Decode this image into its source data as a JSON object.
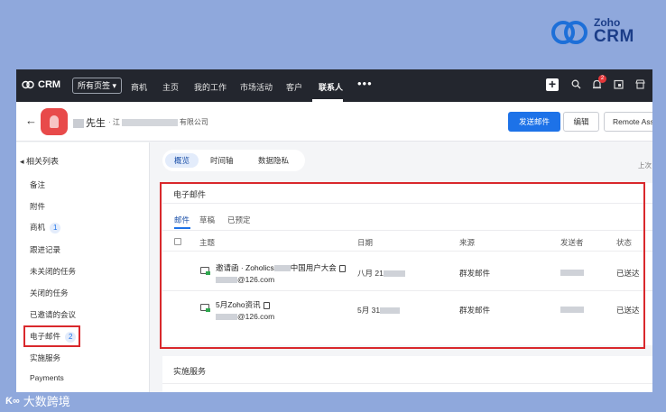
{
  "brand": {
    "line1": "Zoho",
    "line2": "CRM"
  },
  "topnav": {
    "logo": "CRM",
    "all_pages": "所有页签 ▾",
    "items": [
      "商机",
      "主页",
      "我的工作",
      "市场活动",
      "客户",
      "联系人"
    ],
    "active_item": "联系人",
    "more": "•••",
    "plus": "+",
    "notification_count": "2"
  },
  "record": {
    "name": "先生",
    "company_prefix": "· 江",
    "company_suffix": "有限公司",
    "send_email": "发送邮件",
    "edit": "编辑",
    "remote": "Remote Assist"
  },
  "sidebar": {
    "title": "相关列表",
    "items": [
      {
        "label": "备注"
      },
      {
        "label": "附件"
      },
      {
        "label": "商机",
        "count": "1"
      },
      {
        "label": "跟进记录"
      },
      {
        "label": "未关闭的任务"
      },
      {
        "label": "关闭的任务"
      },
      {
        "label": "已邀请的会议"
      },
      {
        "label": "电子邮件",
        "count": "2"
      },
      {
        "label": "实施服务"
      },
      {
        "label": "Payments"
      }
    ]
  },
  "tabs": [
    "概览",
    "时间轴",
    "数据隐私"
  ],
  "last_viewed": "上次",
  "email_card": {
    "title": "电子邮件",
    "subtabs": [
      "邮件",
      "草稿",
      "已预定"
    ],
    "columns": [
      "主题",
      "日期",
      "来源",
      "发送者",
      "状态"
    ],
    "rows": [
      {
        "subject_a": "邀请函 · Zoholics",
        "subject_b": "中国用户大会",
        "address": "@126.com",
        "date": "八月 21",
        "source": "群发邮件",
        "status": "已送达"
      },
      {
        "subject_a": "5月Zoho资讯",
        "subject_b": "",
        "address": "@126.com",
        "date": "5月 31",
        "source": "群发邮件",
        "status": "已送达"
      }
    ]
  },
  "service_card": {
    "title": "实施服务"
  },
  "watermark": {
    "logo": "Ƙ∞",
    "text": "大数跨境"
  },
  "colors": {
    "primary": "#1d72e8",
    "highlight": "#d9282c",
    "nav_bg": "#23262e",
    "page_bg": "#8fa8dc"
  }
}
